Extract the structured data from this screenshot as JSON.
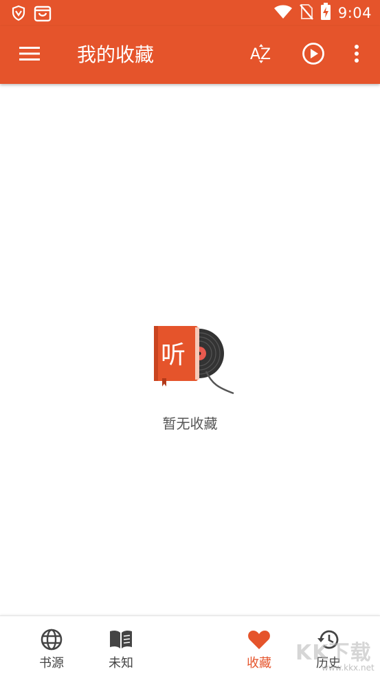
{
  "status_bar": {
    "time": "9:04",
    "icons": [
      "shield-icon",
      "store-bag-icon",
      "wifi-icon",
      "no-sim-icon",
      "battery-charging-icon"
    ]
  },
  "toolbar": {
    "title": "我的收藏",
    "sort_label": "AZ",
    "icons": [
      "menu-icon",
      "sort-az-icon",
      "play-circle-icon",
      "more-vert-icon"
    ]
  },
  "empty_state": {
    "illustration_text": "听",
    "message": "暂无收藏"
  },
  "bottom_nav": {
    "items": [
      {
        "label": "书源",
        "icon": "globe-icon",
        "active": false
      },
      {
        "label": "未知",
        "icon": "book-open-icon",
        "active": false
      },
      {
        "label": "收藏",
        "icon": "heart-icon",
        "active": true
      },
      {
        "label": "历史",
        "icon": "history-icon",
        "active": false
      }
    ]
  },
  "watermark": {
    "text": "KK下载",
    "url": "www.kkx.net"
  },
  "colors": {
    "primary": "#e5542b",
    "background": "#ffffff",
    "text_secondary": "#555555",
    "nav_inactive": "#444444"
  }
}
